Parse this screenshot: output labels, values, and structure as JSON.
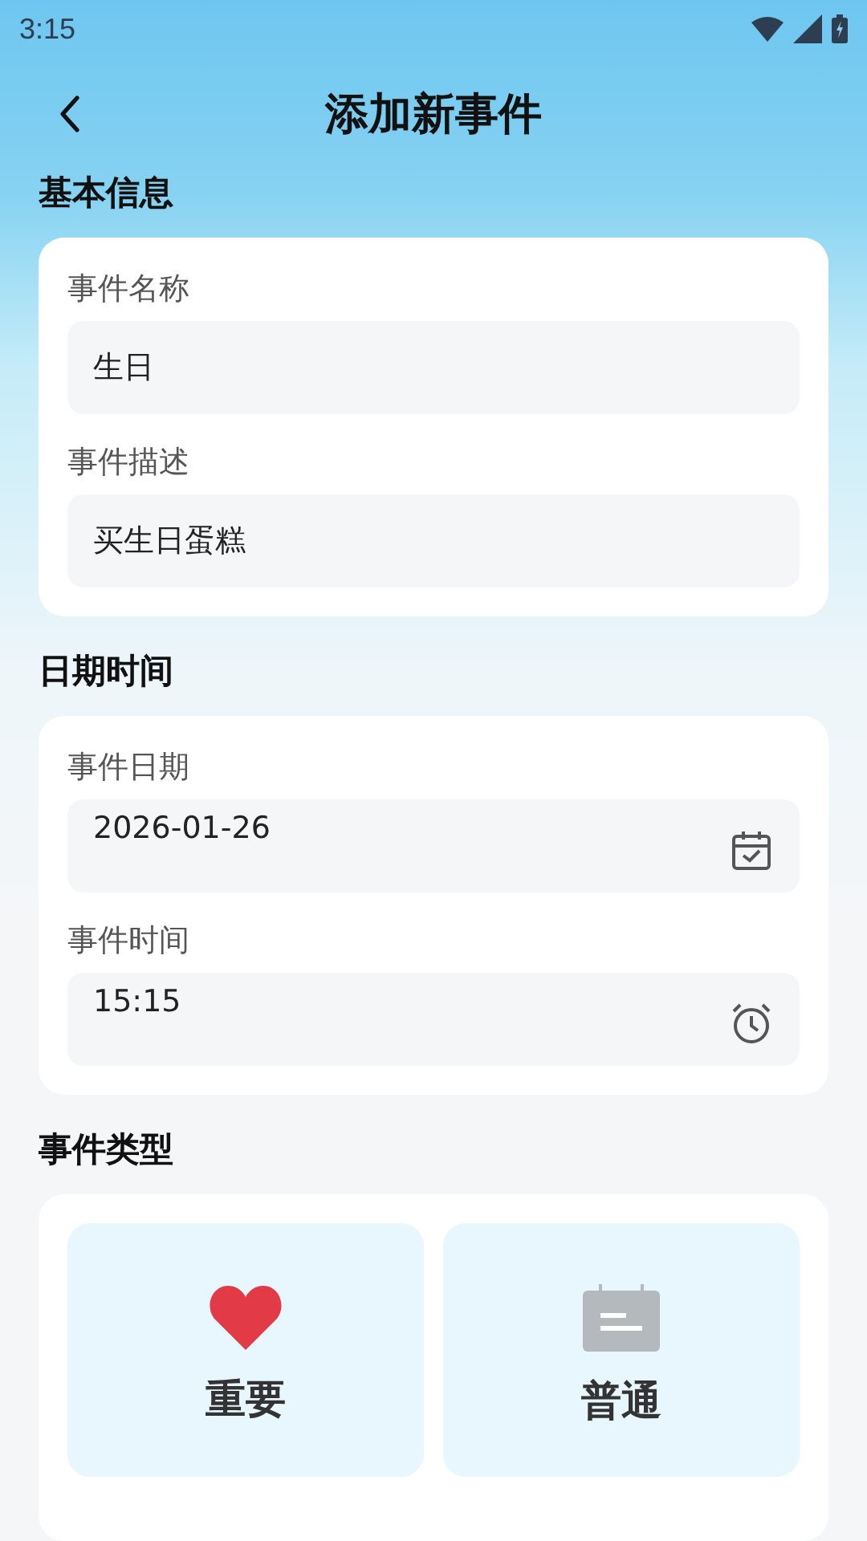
{
  "status_bar": {
    "time": "3:15"
  },
  "header": {
    "title": "添加新事件"
  },
  "sections": [
    {
      "title": "基本信息",
      "fields": [
        {
          "label": "事件名称",
          "value": "生日",
          "kind": "text"
        },
        {
          "label": "事件描述",
          "value": "买生日蛋糕",
          "kind": "text"
        }
      ]
    },
    {
      "title": "日期时间",
      "fields": [
        {
          "label": "事件日期",
          "value": "2026-01-26",
          "kind": "date"
        },
        {
          "label": "事件时间",
          "value": "15:15",
          "kind": "time"
        }
      ]
    }
  ],
  "event_type": {
    "title": "事件类型",
    "options": [
      {
        "label": "重要",
        "kind": "heart"
      },
      {
        "label": "普通",
        "kind": "calendar"
      }
    ]
  }
}
